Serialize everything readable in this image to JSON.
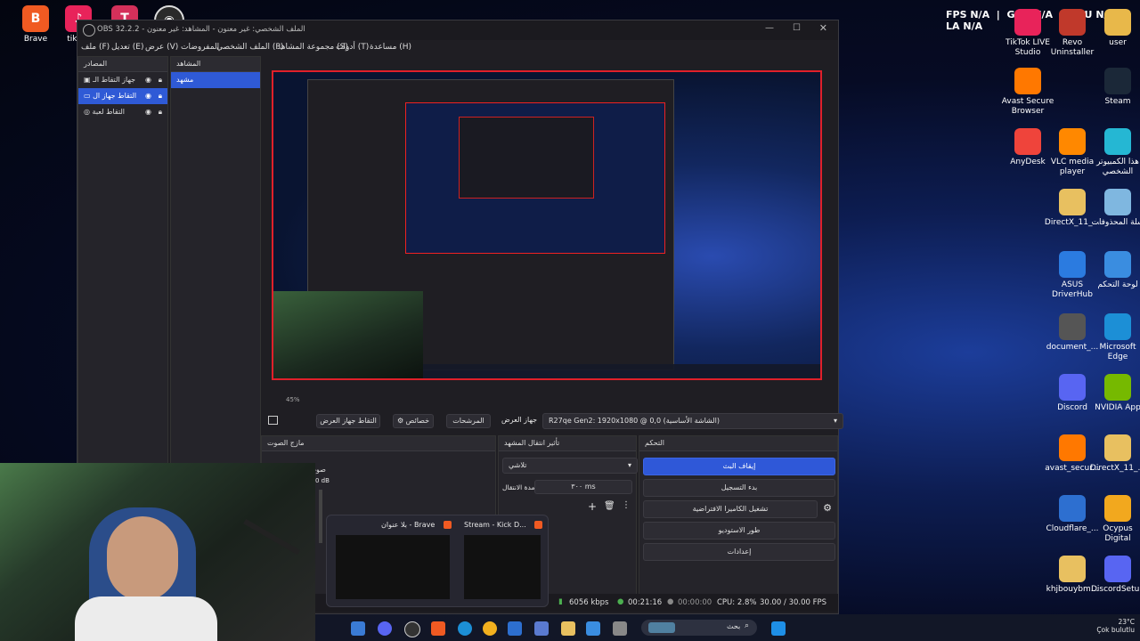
{
  "overlay": {
    "fps_label": "FPS",
    "fps_value": "N/A",
    "gpu_label": "GPU",
    "gpu_value": "N/A",
    "cpu_label": "CPU",
    "cpu_value": "N/A",
    "lat_label": "LA",
    "lat_value": "N/A"
  },
  "desktop_left": [
    {
      "label": "Brave",
      "icon": "brave-icon",
      "color": "#f05a22"
    },
    {
      "label": "tiktok",
      "icon": "tiktok-icon",
      "color": "#e8235a"
    },
    {
      "label": "",
      "icon": "app-icon",
      "color": "#d4305a"
    },
    {
      "label": "",
      "icon": "obs-icon",
      "color": "#2a2a2a"
    }
  ],
  "desktop_right": [
    {
      "label": "TikTok LIVE Studio",
      "icon": "tiktok-live-icon",
      "color": "#e8235a"
    },
    {
      "label": "Revo Uninstaller",
      "icon": "revo-icon",
      "color": "#c0392b"
    },
    {
      "label": "user",
      "icon": "folder-user-icon",
      "color": "#e8b84a"
    },
    {
      "label": "Avast Secure Browser",
      "icon": "avast-browser-icon",
      "color": "#ff7800"
    },
    {
      "label": "Steam",
      "icon": "steam-icon",
      "color": "#1b2838"
    },
    {
      "label": "AnyDesk",
      "icon": "anydesk-icon",
      "color": "#ef443b"
    },
    {
      "label": "VLC media player",
      "icon": "vlc-icon",
      "color": "#ff8800"
    },
    {
      "label": "هذا الكمبيوتر الشخصي",
      "icon": "this-pc-icon",
      "color": "#25b7d3"
    },
    {
      "label": "DirectX_11_...",
      "icon": "folder-icon",
      "color": "#e8c060"
    },
    {
      "label": "سلة المحذوفات",
      "icon": "recycle-bin-icon",
      "color": "#7fb7e0"
    },
    {
      "label": "ASUS DriverHub",
      "icon": "asus-icon",
      "color": "#2b7be0"
    },
    {
      "label": "لوحة التحكم",
      "icon": "control-panel-icon",
      "color": "#3a8de0"
    },
    {
      "label": "document_...",
      "icon": "document-icon",
      "color": "#555"
    },
    {
      "label": "Microsoft Edge",
      "icon": "edge-icon",
      "color": "#1c8fd6"
    },
    {
      "label": "Discord",
      "icon": "discord-icon",
      "color": "#5865f2"
    },
    {
      "label": "NVIDIA App",
      "icon": "nvidia-icon",
      "color": "#76b900"
    },
    {
      "label": "avast_secur...",
      "icon": "avast-icon",
      "color": "#ff7800"
    },
    {
      "label": "DirectX_11_...",
      "icon": "archive-icon",
      "color": "#e8c060"
    },
    {
      "label": "Cloudflare_...",
      "icon": "cloudflare-icon",
      "color": "#2d6fd0"
    },
    {
      "label": "Ocypus Digital",
      "icon": "ocypus-icon",
      "color": "#f2a81e"
    },
    {
      "label": "khjbouybm...",
      "icon": "folder-icon",
      "color": "#e8c060"
    },
    {
      "label": "DiscordSetup",
      "icon": "discord-setup-icon",
      "color": "#5865f2"
    }
  ],
  "obs": {
    "title": "OBS 32.2.2 - الملف الشخصي: غير معنون - المشاهد: غير معنون",
    "menus": [
      "ملف (F)",
      "تعديل (E)",
      "عرض (V)",
      "الملف الشخصي (P)",
      "مجموعة المشاهد (S)",
      "أدوات (T)",
      "مساعدة (H)",
      "المفروضات"
    ],
    "sources_title": "المصادر",
    "sources": [
      "جهاز التقاط الـ",
      "التقاط جهاز ال",
      "التقاط لعبة"
    ],
    "scenes_title": "المشاهد",
    "scenes": [
      "مشهد"
    ],
    "source_toolbar": {
      "device_label": "جهاز العرض",
      "device_value": "R27qe Gen2: 1920x1080 @ 0,0 (الشاشة الأساسية)",
      "filters": "المرشحات",
      "properties": "خصائص",
      "capture": "التقاط جهاز العرض"
    },
    "mixer_title": "مازج الصوت",
    "mixer_track": "صوت سطح المكتب",
    "mixer_db": "0 dB",
    "transitions_title": "تأثير انتقال المشهد",
    "transition_value": "تلاشي",
    "duration_label": "مدة الانتقال",
    "duration_value": "٣٠٠ ms",
    "controls_title": "التحكم",
    "controls": [
      "إيقاف البث",
      "بدء التسجيل",
      "تشغيل الكاميرا الافتراضية",
      "طور الاستوديو",
      "إعدادات"
    ],
    "status": {
      "kbps": "6056 kbps",
      "stream_time": "00:21:16",
      "rec_time": "00:00:00",
      "cpu": "CPU: 2.8%",
      "fps": "30.00 / 30.00 FPS"
    },
    "preview_bottom_left": "45%"
  },
  "thumbs": [
    {
      "label": "بلا عنوان - Brave"
    },
    {
      "label": "Stream - Kick D..."
    }
  ],
  "taskbar": {
    "search": "بحث"
  },
  "tray": {
    "temp": "23°C",
    "weather": "Çok bulutlu"
  }
}
